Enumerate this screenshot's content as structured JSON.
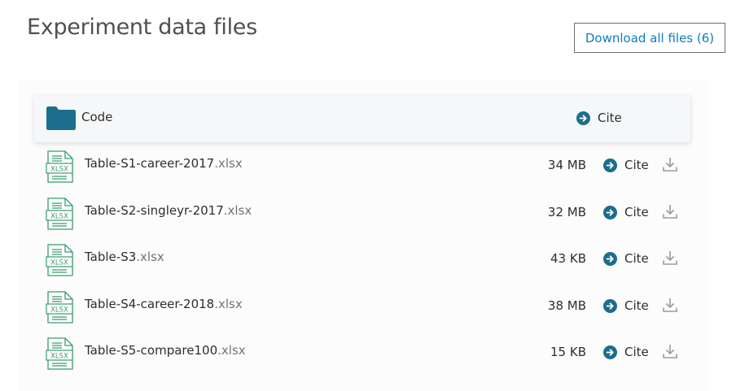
{
  "page": {
    "title": "Experiment data files",
    "download_all_label": "Download all files (6)"
  },
  "folder": {
    "name": "Code",
    "cite_label": "Cite"
  },
  "files": [
    {
      "base": "Table-S1-career-2017",
      "ext": ".xlsx",
      "size": "34 MB",
      "cite_label": "Cite"
    },
    {
      "base": "Table-S2-singleyr-2017",
      "ext": ".xlsx",
      "size": "32 MB",
      "cite_label": "Cite"
    },
    {
      "base": "Table-S3",
      "ext": ".xlsx",
      "size": "43 KB",
      "cite_label": "Cite"
    },
    {
      "base": "Table-S4-career-2018",
      "ext": ".xlsx",
      "size": "38 MB",
      "cite_label": "Cite"
    },
    {
      "base": "Table-S5-compare100",
      "ext": ".xlsx",
      "size": "15 KB",
      "cite_label": "Cite"
    }
  ],
  "icons": {
    "folder": "folder-icon",
    "file": "xlsx-file-icon",
    "cite": "arrow-right-circle-icon",
    "download": "download-icon",
    "file_icon_text": "XLSX"
  },
  "colors": {
    "accent": "#1c6e8c",
    "link": "#0c7dbb",
    "file_icon": "#3a9a6e",
    "download_icon": "#9b9b9b"
  }
}
